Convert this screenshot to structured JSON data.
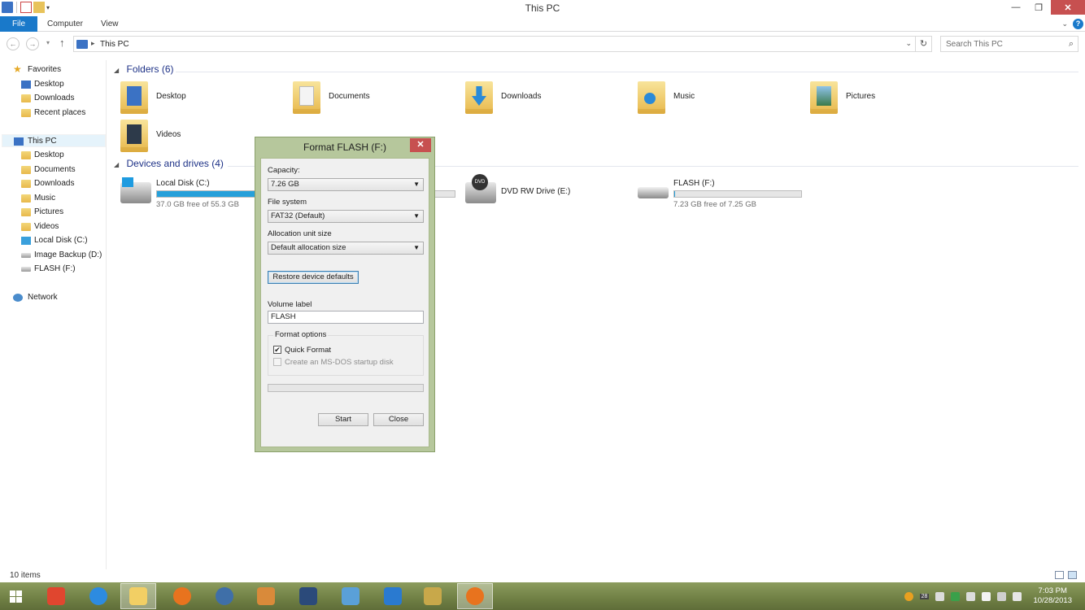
{
  "window": {
    "title": "This PC",
    "controls": {
      "minimize": "—",
      "maximize": "❐",
      "close": "✕"
    }
  },
  "ribbon": {
    "tabs": [
      "File",
      "Computer",
      "View"
    ],
    "help": "?"
  },
  "address": {
    "path": "This PC",
    "search_placeholder": "Search This PC"
  },
  "nav": {
    "favorites": {
      "label": "Favorites",
      "items": [
        "Desktop",
        "Downloads",
        "Recent places"
      ]
    },
    "this_pc": {
      "label": "This PC",
      "items": [
        "Desktop",
        "Documents",
        "Downloads",
        "Music",
        "Pictures",
        "Videos",
        "Local Disk (C:)",
        "Image Backup (D:)",
        "FLASH (F:)"
      ]
    },
    "network": "Network"
  },
  "content": {
    "folders_group": "Folders (6)",
    "folders": [
      "Desktop",
      "Documents",
      "Downloads",
      "Music",
      "Pictures",
      "Videos"
    ],
    "devices_group": "Devices and drives (4)",
    "drives": [
      {
        "name": "Local Disk (C:)",
        "free": "37.0 GB free of 55.3 GB",
        "used_fraction": 0.33
      },
      {
        "name": "DVD RW Drive (E:)"
      },
      {
        "name": "FLASH (F:)",
        "free": "7.23 GB free of 7.25 GB",
        "used_fraction": 0.003
      }
    ]
  },
  "status": {
    "items": "10 items"
  },
  "dialog": {
    "title": "Format FLASH (F:)",
    "close": "✕",
    "capacity_label": "Capacity:",
    "capacity_value": "7.26 GB",
    "filesystem_label": "File system",
    "filesystem_value": "FAT32 (Default)",
    "alloc_label": "Allocation unit size",
    "alloc_value": "Default allocation size",
    "restore_button": "Restore device defaults",
    "volume_label": "Volume label",
    "volume_value": "FLASH",
    "format_options": "Format options",
    "quick_format": "Quick Format",
    "quick_format_checked": true,
    "msdos": "Create an MS-DOS startup disk",
    "start_button": "Start",
    "close_button": "Close"
  },
  "taskbar": {
    "clock_time": "7:03 PM",
    "clock_date": "10/28/2013",
    "tray_badge": "28"
  }
}
